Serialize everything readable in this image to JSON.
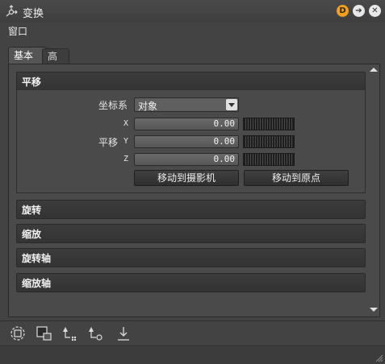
{
  "window": {
    "title": "变换",
    "icon": "transform-icon",
    "buttons": [
      {
        "label": "D",
        "icon": "d-badge-icon",
        "color": "#f0a020"
      },
      {
        "label": "",
        "icon": "arrow-right-circle-icon"
      },
      {
        "label": "",
        "icon": "close-circle-icon"
      }
    ]
  },
  "menubar": {
    "items": [
      "窗口"
    ]
  },
  "tabs": [
    {
      "label": "基本",
      "selected": true
    },
    {
      "label": "高级",
      "selected": false
    }
  ],
  "sections": {
    "move": {
      "title": "平移",
      "coord_label": "坐标系",
      "coord_value": "对象",
      "axes_group_label": "平移",
      "axes": [
        {
          "axis": "X",
          "value": "0.00"
        },
        {
          "axis": "Y",
          "value": "0.00"
        },
        {
          "axis": "Z",
          "value": "0.00"
        }
      ],
      "move_to_camera": "移动到摄影机",
      "move_to_origin": "移动到原点"
    },
    "rotate": {
      "title": "旋转"
    },
    "scale": {
      "title": "缩放"
    },
    "rotate_axis": {
      "title": "旋转轴"
    },
    "scale_axis": {
      "title": "缩放轴"
    }
  },
  "toolbar": {
    "icons": [
      "rotate-frame-icon",
      "select-frame-icon",
      "pin-snap-icon",
      "pin-origin-icon",
      "drop-down-icon"
    ]
  },
  "colors": {
    "background": "#434343",
    "panel": "#4a4a4a",
    "accent": "#f0a020"
  }
}
